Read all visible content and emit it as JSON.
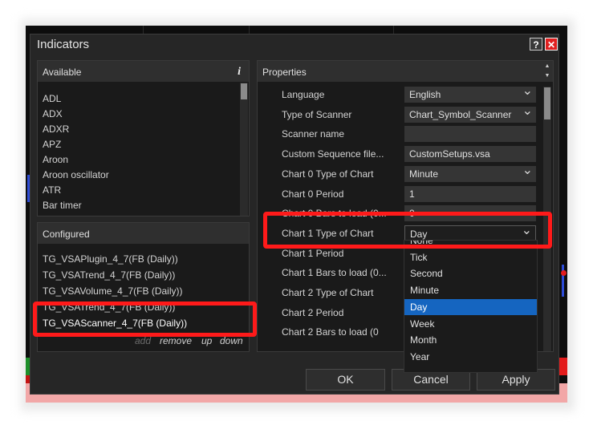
{
  "dialog": {
    "title": "Indicators",
    "help_glyph": "?",
    "close_glyph": "✕"
  },
  "available": {
    "header": "Available",
    "info_glyph": "i",
    "items": [
      "ADL",
      "ADX",
      "ADXR",
      "APZ",
      "Aroon",
      "Aroon oscillator",
      "ATR",
      "Bar timer"
    ]
  },
  "configured": {
    "header": "Configured",
    "items": [
      "TG_VSAPlugin_4_7(FB (Daily))",
      "TG_VSATrend_4_7(FB (Daily))",
      "TG_VSAVolume_4_7(FB (Daily))",
      "TG_VSATrend_4_7(FB (Daily))",
      "TG_VSAScanner_4_7(FB (Daily))"
    ],
    "links": {
      "add": "add",
      "remove": "remove",
      "up": "up",
      "down": "down"
    }
  },
  "properties": {
    "header": "Properties",
    "rows": [
      {
        "label": "Language",
        "value": "English",
        "dropdown": true
      },
      {
        "label": "Type of Scanner",
        "value": "Chart_Symbol_Scanner",
        "dropdown": true
      },
      {
        "label": "Scanner name",
        "value": "",
        "dropdown": false
      },
      {
        "label": "Custom Sequence file...",
        "value": "CustomSetups.vsa",
        "dropdown": false
      },
      {
        "label": "Chart 0 Type of Chart",
        "value": "Minute",
        "dropdown": true
      },
      {
        "label": "Chart 0 Period",
        "value": "1",
        "dropdown": false
      },
      {
        "label": "Chart 0 Bars to load (0...",
        "value": "0",
        "dropdown": false
      },
      {
        "label": "Chart 1 Type of Chart",
        "value": "Day",
        "dropdown": true
      },
      {
        "label": "Chart 1 Period",
        "value": "",
        "dropdown": false
      },
      {
        "label": "Chart 1 Bars to load (0...",
        "value": "",
        "dropdown": false
      },
      {
        "label": "Chart 2 Type of Chart",
        "value": "",
        "dropdown": false
      },
      {
        "label": "Chart 2 Period",
        "value": "",
        "dropdown": false
      },
      {
        "label": "Chart 2 Bars to load (0",
        "value": "",
        "dropdown": false
      }
    ]
  },
  "chart_type_dropdown": {
    "options": [
      "None",
      "Tick",
      "Second",
      "Minute",
      "Day",
      "Week",
      "Month",
      "Year"
    ],
    "selected": "Day"
  },
  "buttons": {
    "ok": "OK",
    "cancel": "Cancel",
    "apply": "Apply"
  },
  "colors": {
    "highlight": "#ff1a1a",
    "selection": "#1565c0",
    "dialog_bg": "#262626"
  }
}
